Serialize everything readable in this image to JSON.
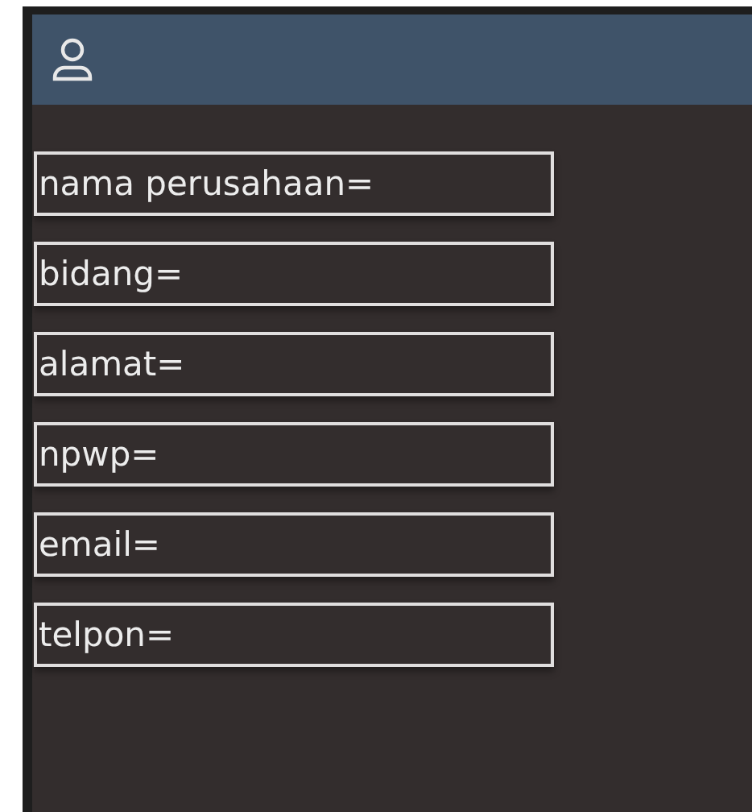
{
  "fields": [
    {
      "label": "nama perusahaan="
    },
    {
      "label": "bidang="
    },
    {
      "label": "alamat="
    },
    {
      "label": "npwp="
    },
    {
      "label": "email="
    },
    {
      "label": "telpon="
    }
  ]
}
